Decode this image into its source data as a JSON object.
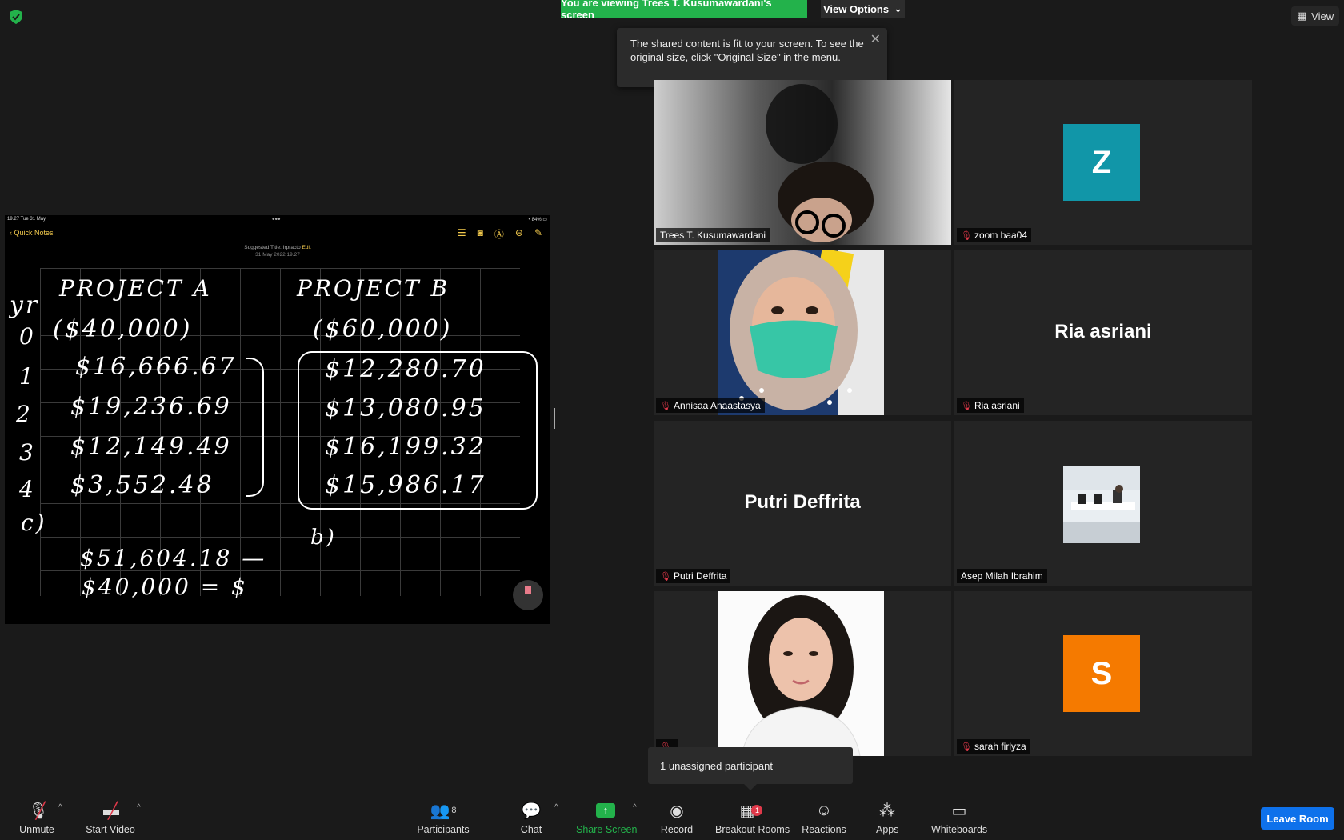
{
  "banner": {
    "viewing_text": "You are viewing Trees T. Kusumawardani's screen",
    "view_options": "View Options"
  },
  "view_button": "View",
  "tooltip": {
    "text": "The shared content is fit to your screen. To see the original size, click \"Original Size\" in the menu."
  },
  "shared_screen": {
    "status_time": "19.27  Tue 31 May",
    "status_right": "84%",
    "back_label": "Quick Notes",
    "suggested_title": "Suggested Title: Irpracto",
    "edit_label": "Edit",
    "note_date": "31 May 2022 19.27",
    "notes": {
      "yr": "yr",
      "proj_a": "PROJECT A",
      "proj_b": "PROJECT B",
      "years": [
        "0",
        "1",
        "2",
        "3",
        "4"
      ],
      "a_values": [
        "($40,000)",
        "$16,666.67",
        "$19,236.69",
        "$12,149.49",
        "$3,552.48"
      ],
      "b_values": [
        "($60,000)",
        "$12,280.70",
        "$13,080.95",
        "$16,199.32",
        "$15,986.17"
      ],
      "c_label": "c)",
      "b_label": "b)",
      "sum_line1": "$51,604.18 —",
      "sum_line2": "$40,000 = $"
    }
  },
  "participants": [
    {
      "name": "Trees T. Kusumawardani",
      "muted": false,
      "active": true,
      "kind": "video"
    },
    {
      "name": "zoom baa04",
      "muted": true,
      "kind": "avatar",
      "initial": "Z",
      "color": "#1196a8"
    },
    {
      "name": "Annisaa Anaastasya",
      "muted": true,
      "kind": "photo"
    },
    {
      "name": "Ria asriani",
      "muted": true,
      "kind": "bigname"
    },
    {
      "name": "Putri Deffrita",
      "muted": true,
      "kind": "bigname"
    },
    {
      "name": "Asep Milah Ibrahim",
      "muted": false,
      "kind": "photo"
    },
    {
      "name": "",
      "muted": true,
      "kind": "photo"
    },
    {
      "name": "sarah firlyza",
      "muted": true,
      "kind": "avatar",
      "initial": "S",
      "color": "#f57a00"
    }
  ],
  "unassigned": "1 unassigned participant",
  "toolbar": {
    "unmute": "Unmute",
    "start_video": "Start Video",
    "participants": "Participants",
    "participants_count": "8",
    "chat": "Chat",
    "share_screen": "Share Screen",
    "record": "Record",
    "breakout": "Breakout Rooms",
    "breakout_badge": "1",
    "reactions": "Reactions",
    "apps": "Apps",
    "whiteboards": "Whiteboards",
    "leave": "Leave Room"
  },
  "colors": {
    "accent_green": "#23b24b",
    "leave_blue": "#0e71eb",
    "active_border": "#d8f07a"
  }
}
